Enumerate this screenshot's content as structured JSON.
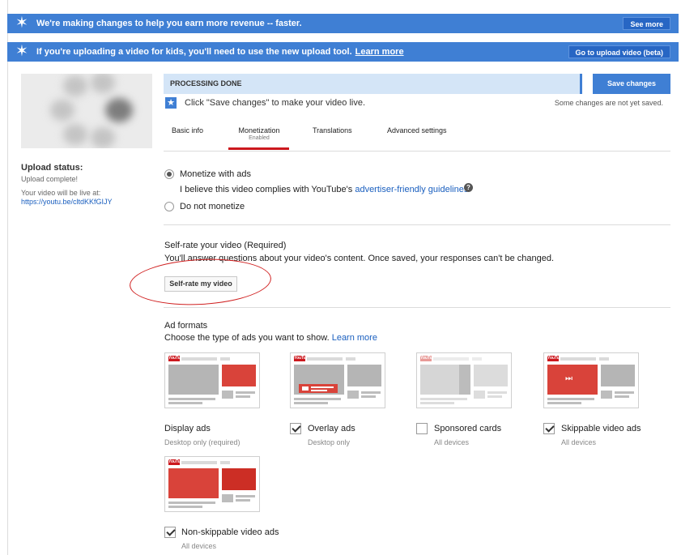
{
  "banners": [
    {
      "text": "We're making changes to help you earn more revenue -- faster.",
      "link": "",
      "button": "See more"
    },
    {
      "text": "If you're uploading a video for kids, you'll need to use the new upload tool.",
      "link": "Learn more",
      "button": "Go to upload video (beta)"
    }
  ],
  "upload_status": {
    "title": "Upload status:",
    "complete": "Upload complete!",
    "live_text": "Your video will be live at:",
    "url": "https://youtu.be/cltdKKfGIJY"
  },
  "processing": {
    "status": "PROCESSING DONE",
    "save_label": "Save changes",
    "info": "Click \"Save changes\" to make your video live.",
    "note": "Some changes are not yet saved."
  },
  "tabs": [
    {
      "label": "Basic info",
      "sub": ""
    },
    {
      "label": "Monetization",
      "sub": "Enabled"
    },
    {
      "label": "Translations",
      "sub": ""
    },
    {
      "label": "Advanced settings",
      "sub": ""
    }
  ],
  "monetization": {
    "option_ads": "Monetize with ads",
    "compliance_text": "I believe this video complies with YouTube's",
    "compliance_link": "advertiser-friendly guidelines",
    "option_none": "Do not monetize",
    "selected": "Monetize with ads"
  },
  "self_rate": {
    "heading": "Self-rate your video (Required)",
    "description": "You'll answer questions about your video's content. Once saved, your responses can't be changed.",
    "button": "Self-rate my video"
  },
  "ad_formats": {
    "heading": "Ad formats",
    "subheading": "Choose the type of ads you want to show.",
    "link": "Learn more",
    "logo_text": "YouTube",
    "items": [
      {
        "label": "Display ads",
        "sub": "Desktop only (required)",
        "checked": false
      },
      {
        "label": "Overlay ads",
        "sub": "Desktop only",
        "checked": true
      },
      {
        "label": "Sponsored cards",
        "sub": "All devices",
        "checked": false
      },
      {
        "label": "Skippable video ads",
        "sub": "All devices",
        "checked": true
      },
      {
        "label": "Non-skippable video ads",
        "sub": "All devices",
        "checked": true
      }
    ]
  },
  "colors": {
    "banner": "#3f7fd4",
    "accent_red": "#cc181e",
    "link_blue": "#1a5fbf",
    "ad_red": "#d9433a"
  }
}
